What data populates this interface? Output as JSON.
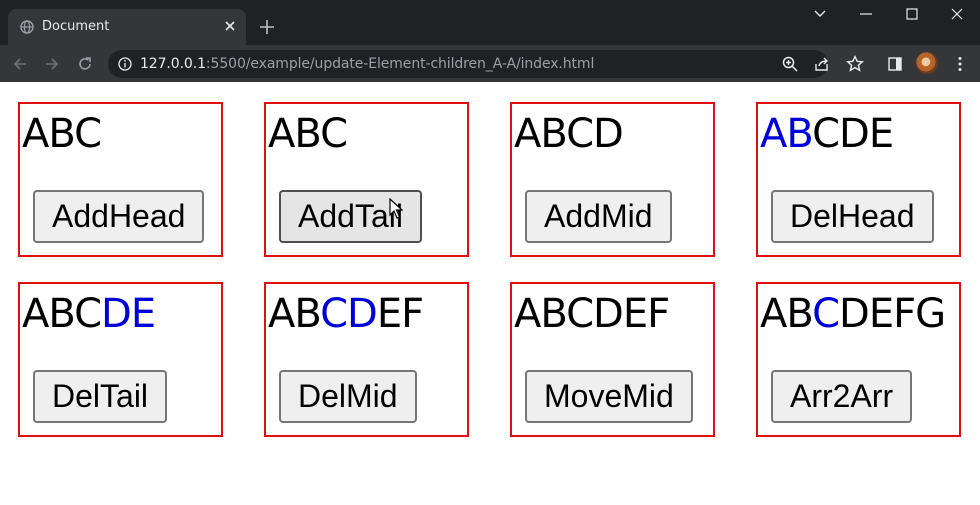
{
  "browser": {
    "tab_title": "Document",
    "url_host": "127.0.0.1",
    "url_path": ":5500/example/update-Element-children_A-A/index.html"
  },
  "cards": [
    {
      "segments": [
        {
          "t": "ABC",
          "hl": false
        }
      ],
      "button": "AddHead"
    },
    {
      "segments": [
        {
          "t": "ABC",
          "hl": false
        }
      ],
      "button": "AddTail"
    },
    {
      "segments": [
        {
          "t": "ABCD",
          "hl": false
        }
      ],
      "button": "AddMid"
    },
    {
      "segments": [
        {
          "t": "AB",
          "hl": true
        },
        {
          "t": "CDE",
          "hl": false
        }
      ],
      "button": "DelHead"
    },
    {
      "segments": [
        {
          "t": "ABC",
          "hl": false
        },
        {
          "t": "DE",
          "hl": true
        }
      ],
      "button": "DelTail"
    },
    {
      "segments": [
        {
          "t": "AB",
          "hl": false
        },
        {
          "t": "CD",
          "hl": true
        },
        {
          "t": "EF",
          "hl": false
        }
      ],
      "button": "DelMid"
    },
    {
      "segments": [
        {
          "t": "ABCDEF",
          "hl": false
        }
      ],
      "button": "MoveMid"
    },
    {
      "segments": [
        {
          "t": "AB",
          "hl": false
        },
        {
          "t": "C",
          "hl": true
        },
        {
          "t": "DEFG",
          "hl": false
        }
      ],
      "button": "Arr2Arr"
    }
  ],
  "colors": {
    "border": "#dd1111",
    "highlight": "#0000dd"
  }
}
